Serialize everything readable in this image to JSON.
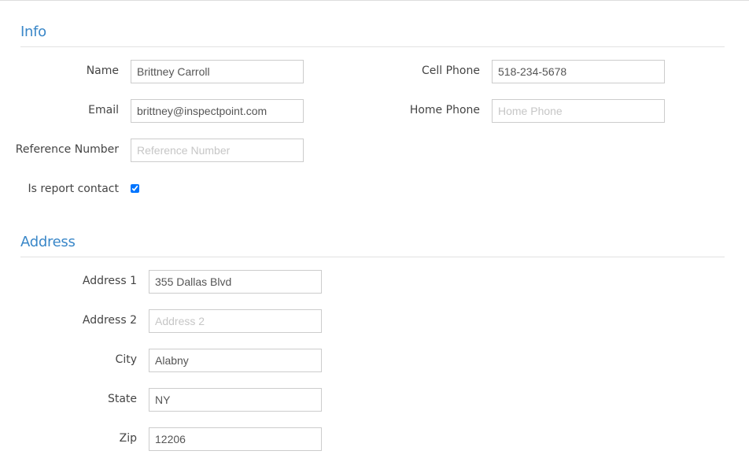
{
  "info": {
    "heading": "Info",
    "name_label": "Name",
    "name_value": "Brittney Carroll",
    "email_label": "Email",
    "email_value": "brittney@inspectpoint.com",
    "reference_label": "Reference Number",
    "reference_placeholder": "Reference Number",
    "report_contact_label": "Is report contact",
    "report_contact_checked": true,
    "cell_phone_label": "Cell Phone",
    "cell_phone_value": "518-234-5678",
    "home_phone_label": "Home Phone",
    "home_phone_placeholder": "Home Phone"
  },
  "address": {
    "heading": "Address",
    "address1_label": "Address 1",
    "address1_value": "355 Dallas Blvd",
    "address2_label": "Address 2",
    "address2_placeholder": "Address 2",
    "city_label": "City",
    "city_value": "Alabny",
    "state_label": "State",
    "state_value": "NY",
    "zip_label": "Zip",
    "zip_value": "12206"
  },
  "colors": {
    "heading": "#3a87c8",
    "border": "#cccccc"
  }
}
